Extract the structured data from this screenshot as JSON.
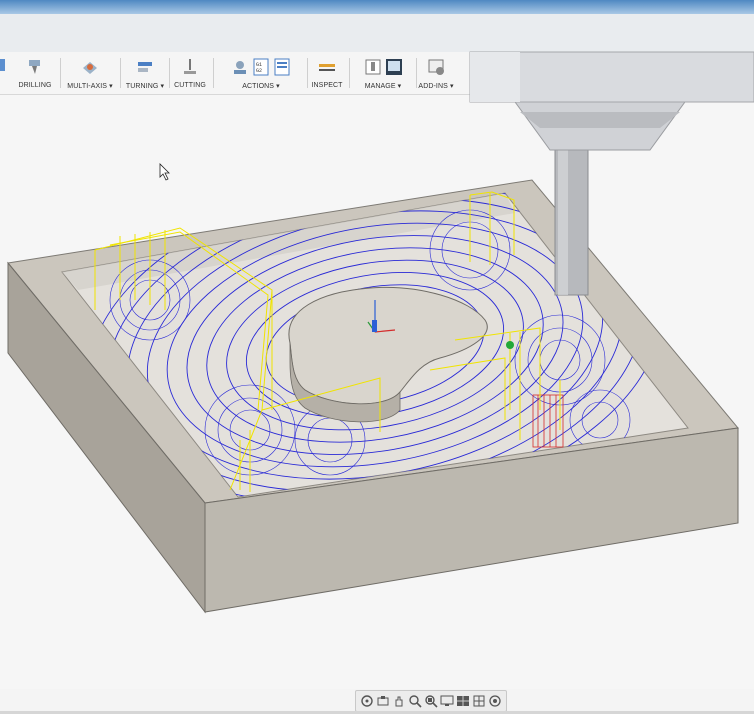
{
  "toolbar": {
    "groups": [
      {
        "label": "DRILLING"
      },
      {
        "label": "MULTI-AXIS ▾"
      },
      {
        "label": "TURNING ▾"
      },
      {
        "label": "CUTTING"
      },
      {
        "label": "ACTIONS ▾"
      },
      {
        "label": "INSPECT"
      },
      {
        "label": "MANAGE ▾"
      },
      {
        "label": "ADD-INS ▾"
      }
    ]
  },
  "icons": {
    "drilling": "drill-icon",
    "multiaxis": "multi-axis-icon",
    "turning": "turning-icon",
    "cutting": "cutting-icon",
    "actions": [
      "simulate-icon",
      "post-process-icon",
      "setup-sheet-icon"
    ],
    "inspect": "measure-icon",
    "manage": [
      "tool-library-icon",
      "template-library-icon"
    ],
    "addins": "add-ins-icon"
  },
  "colors": {
    "stock": "#c9c5bd",
    "stock_dark": "#a9a59d",
    "toolpath_blue": "#2a2ad6",
    "rapid_yellow": "#f0e400",
    "spindle": "#c4c7cc"
  }
}
